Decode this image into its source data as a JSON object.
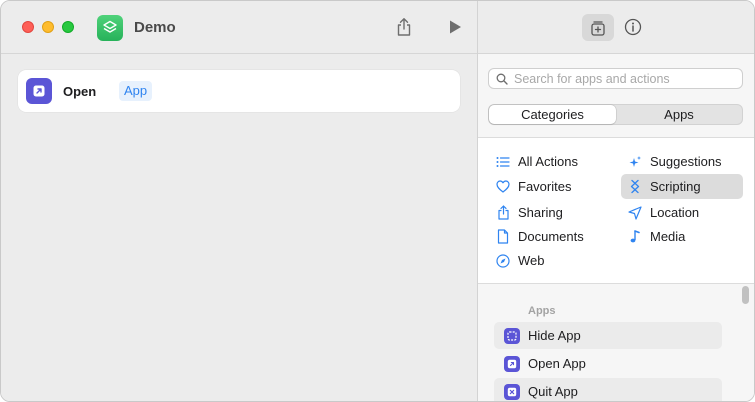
{
  "app": {
    "title": "Demo"
  },
  "toolbar": {
    "share_icon": "share-icon",
    "run_icon": "play-icon",
    "library_icon": "library-add-icon",
    "info_icon": "info-icon"
  },
  "editor": {
    "actions": [
      {
        "verb": "Open",
        "param": "App"
      }
    ]
  },
  "library": {
    "search_placeholder": "Search for apps and actions",
    "segments": [
      "Categories",
      "Apps"
    ],
    "selected_segment": "Categories",
    "categories_left": [
      {
        "label": "All Actions",
        "icon": "list-icon"
      },
      {
        "label": "Favorites",
        "icon": "heart-icon"
      },
      {
        "label": "Sharing",
        "icon": "share-icon"
      },
      {
        "label": "Documents",
        "icon": "document-icon"
      },
      {
        "label": "Web",
        "icon": "compass-icon"
      }
    ],
    "categories_right": [
      {
        "label": "Suggestions",
        "icon": "sparkles-icon"
      },
      {
        "label": "Scripting",
        "icon": "scripting-icon"
      },
      {
        "label": "Location",
        "icon": "location-arrow-icon"
      },
      {
        "label": "Media",
        "icon": "music-note-icon"
      }
    ],
    "selected_category": "Scripting",
    "section_title": "Apps",
    "action_items": [
      {
        "label": "Hide App",
        "icon": "hide-app-icon"
      },
      {
        "label": "Open App",
        "icon": "open-app-icon"
      },
      {
        "label": "Quit App",
        "icon": "quit-app-icon"
      }
    ]
  },
  "colors": {
    "accent": "#2f84f0",
    "action_purple": "#5b55d6",
    "app_green": "#27b25a"
  }
}
